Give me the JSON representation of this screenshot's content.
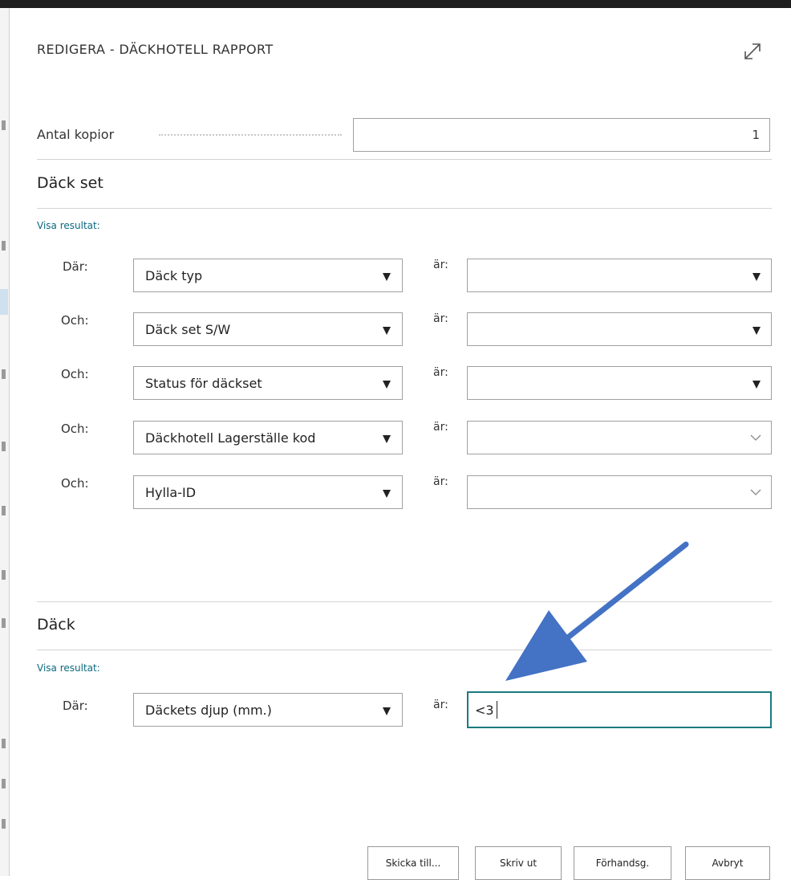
{
  "dialog": {
    "title": "REDIGERA - DÄCKHOTELL RAPPORT",
    "expand_icon": "expand-diagonal-icon"
  },
  "options": {
    "copies_label": "Antal kopior",
    "copies_value": "1"
  },
  "tire_set": {
    "title": "Däck set",
    "show_results_label": "Visa resultat:",
    "rows": [
      {
        "connector": "Där:",
        "field": "Däck typ",
        "is_label": "är:",
        "value": ""
      },
      {
        "connector": "Och:",
        "field": "Däck set S/W",
        "is_label": "är:",
        "value": ""
      },
      {
        "connector": "Och:",
        "field": "Status för däckset",
        "is_label": "är:",
        "value": ""
      },
      {
        "connector": "Och:",
        "field": "Däckhotell Lagerställe kod",
        "is_label": "är:",
        "value": ""
      },
      {
        "connector": "Och:",
        "field": "Hylla-ID",
        "is_label": "är:",
        "value": ""
      }
    ]
  },
  "tire": {
    "title": "Däck",
    "show_results_label": "Visa resultat:",
    "rows": [
      {
        "connector": "Där:",
        "field": "Däckets djup (mm.)",
        "is_label": "är:",
        "value": "<3"
      }
    ]
  },
  "buttons": {
    "send": "Skicka till...",
    "print": "Skriv ut",
    "preview": "Förhandsg.",
    "cancel": "Avbryt"
  },
  "annotation": {
    "arrow_color": "#4472c4"
  }
}
